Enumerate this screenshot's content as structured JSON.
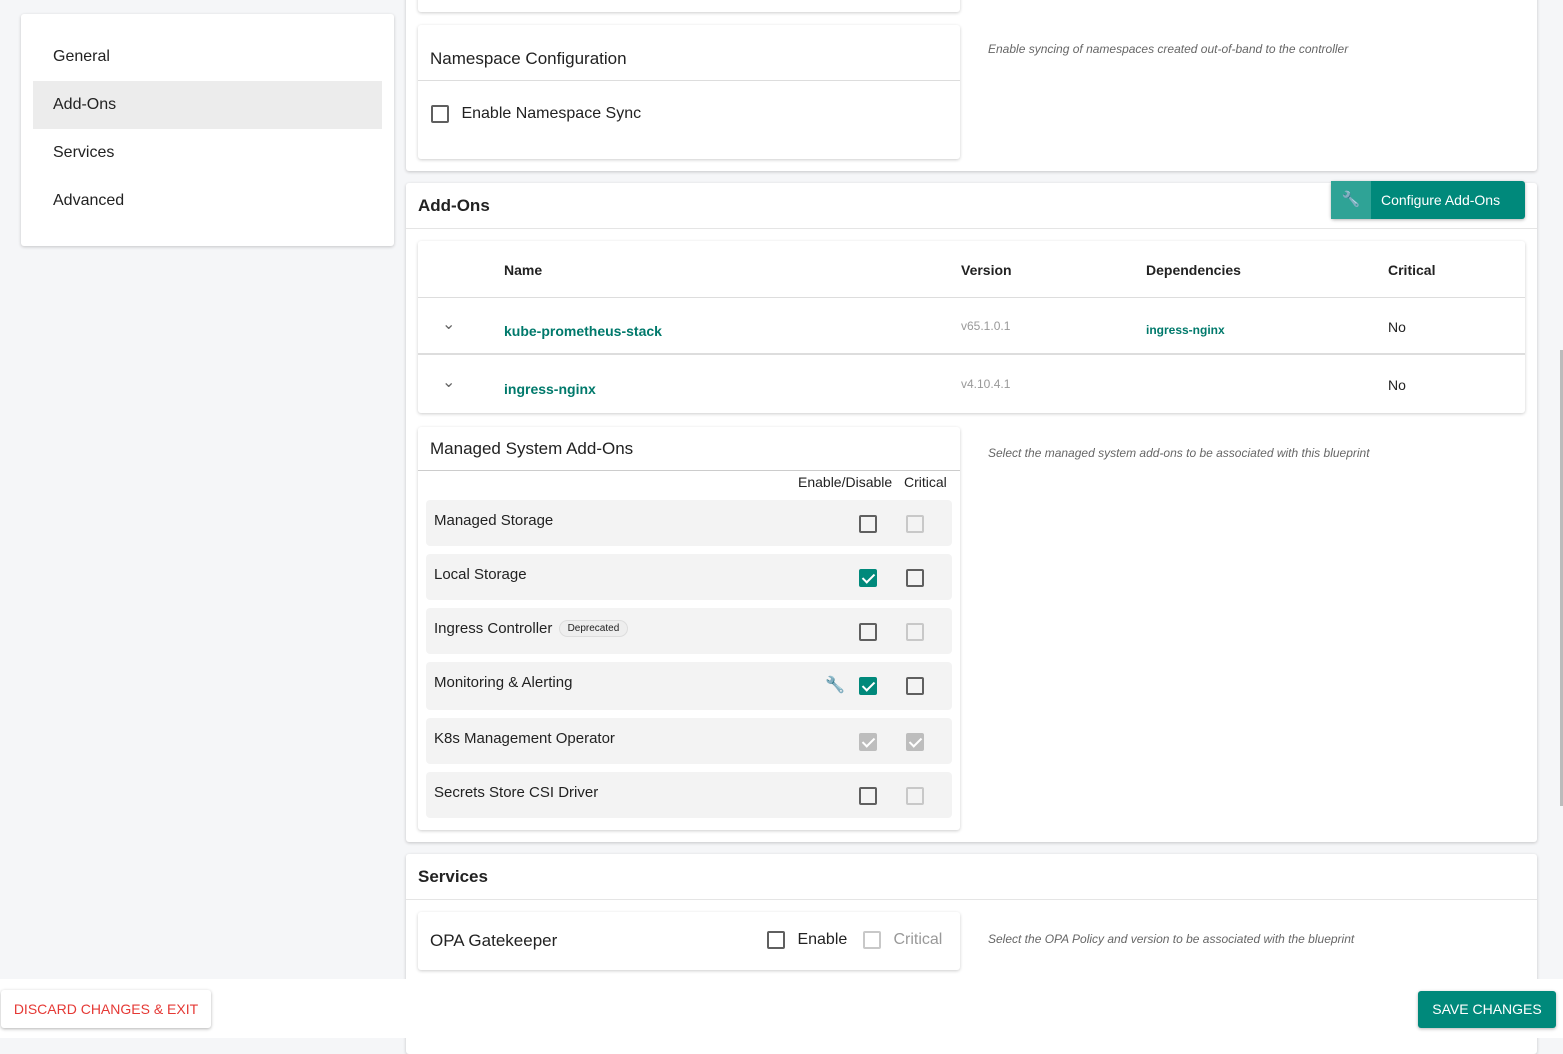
{
  "sidebar": {
    "items": [
      {
        "label": "General"
      },
      {
        "label": "Add-Ons",
        "active": true
      },
      {
        "label": "Services"
      },
      {
        "label": "Advanced"
      }
    ]
  },
  "namespace": {
    "title": "Namespace Configuration",
    "checkbox_label": "Enable Namespace Sync",
    "checked": false,
    "hint": "Enable syncing of namespaces created out-of-band to the controller"
  },
  "addons": {
    "title": "Add-Ons",
    "configure_button": "Configure Add-Ons",
    "configure_icon": "wrench-icon",
    "columns": [
      "Name",
      "Version",
      "Dependencies",
      "Critical"
    ],
    "rows": [
      {
        "name": "kube-prometheus-stack",
        "version": "v65.1.0.1",
        "dependencies": "ingress-nginx",
        "critical": "No"
      },
      {
        "name": "ingress-nginx",
        "version": "v4.10.4.1",
        "dependencies": "",
        "critical": "No"
      }
    ]
  },
  "managed": {
    "title": "Managed System Add-Ons",
    "hint": "Select the managed system add-ons to be associated with this blueprint",
    "col_enable": "Enable/Disable",
    "col_critical": "Critical",
    "items": [
      {
        "label": "Managed Storage",
        "enabled": false,
        "critical": false,
        "critical_disabled": true
      },
      {
        "label": "Local Storage",
        "enabled": true,
        "critical": false
      },
      {
        "label": "Ingress Controller",
        "badge": "Deprecated",
        "enabled": false,
        "critical": false,
        "critical_disabled": true
      },
      {
        "label": "Monitoring & Alerting",
        "enabled": true,
        "critical": false,
        "has_config": true
      },
      {
        "label": "K8s Management Operator",
        "enabled": true,
        "critical": true,
        "locked": true
      },
      {
        "label": "Secrets Store CSI Driver",
        "enabled": false,
        "critical": false,
        "critical_disabled": true
      }
    ]
  },
  "services": {
    "title": "Services",
    "opa": {
      "title": "OPA Gatekeeper",
      "enable_label": "Enable",
      "critical_label": "Critical",
      "hint": "Select the OPA Policy and version to be associated with the blueprint"
    }
  },
  "footer": {
    "discard": "DISCARD CHANGES & EXIT",
    "save": "SAVE CHANGES"
  },
  "colors": {
    "accent": "#00897b",
    "danger": "#e53935"
  }
}
